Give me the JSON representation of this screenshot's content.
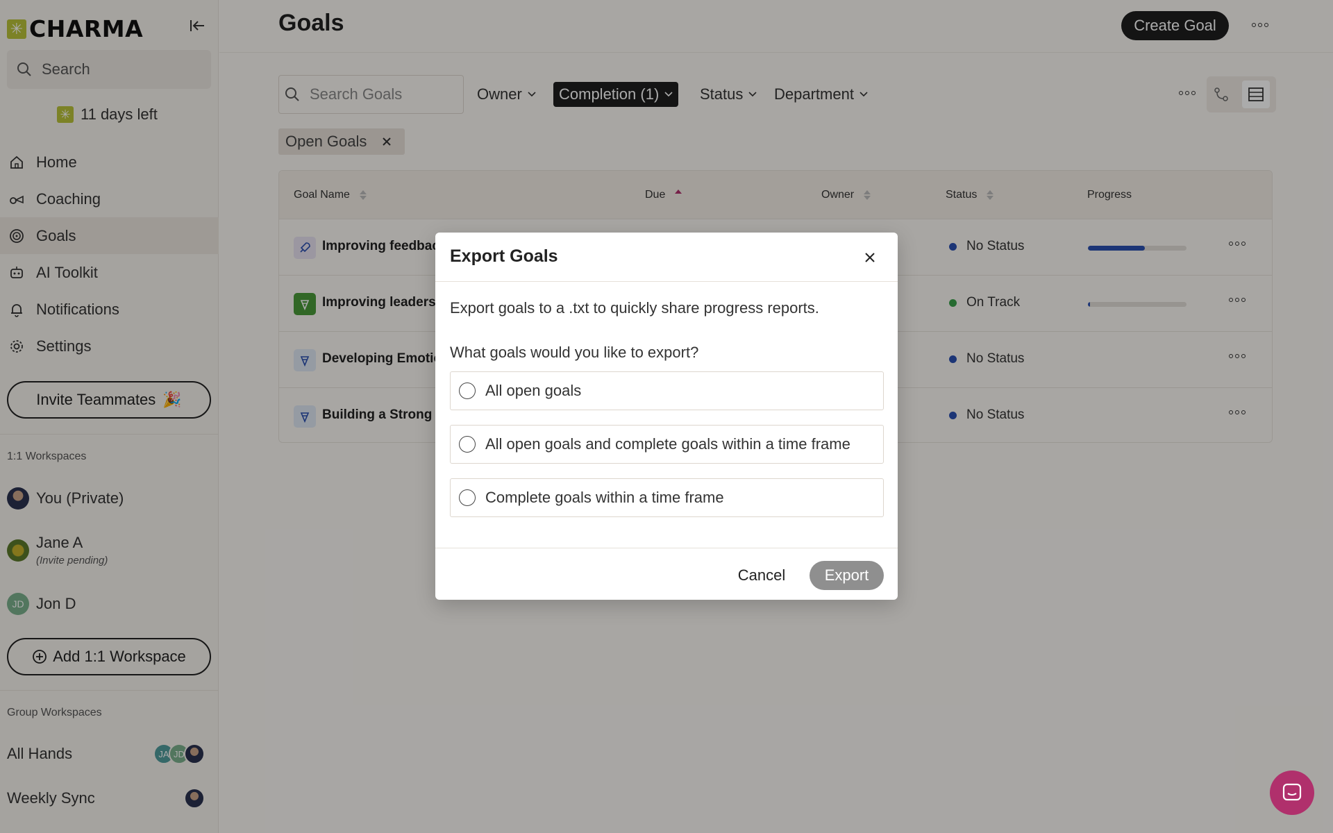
{
  "app": {
    "logo_text": "CHARMA",
    "accent_color": "#b9c23a",
    "chat_color": "#b0306c"
  },
  "sidebar": {
    "search_placeholder": "Search",
    "trial_text": "11 days left",
    "nav": [
      {
        "label": "Home",
        "icon": "home-icon"
      },
      {
        "label": "Coaching",
        "icon": "coaching-icon"
      },
      {
        "label": "Goals",
        "icon": "target-icon",
        "active": true
      },
      {
        "label": "AI Toolkit",
        "icon": "robot-icon"
      },
      {
        "label": "Notifications",
        "icon": "bell-icon"
      },
      {
        "label": "Settings",
        "icon": "gear-icon"
      }
    ],
    "invite_label": "Invite Teammates",
    "invite_emoji": "🎉",
    "one_on_one_label": "1:1 Workspaces",
    "workspaces": [
      {
        "name": "You (Private)",
        "sub": ""
      },
      {
        "name": "Jane A",
        "sub": "(Invite pending)"
      },
      {
        "name": "Jon D",
        "sub": "",
        "initials": "JD"
      }
    ],
    "add_workspace_label": "Add 1:1 Workspace",
    "group_label": "Group Workspaces",
    "groups": [
      {
        "name": "All Hands",
        "avatars": [
          "JA",
          "JD"
        ]
      },
      {
        "name": "Weekly Sync"
      }
    ]
  },
  "main": {
    "title": "Goals",
    "create_label": "Create Goal",
    "search_placeholder": "Search Goals",
    "filters": [
      {
        "label": "Owner"
      },
      {
        "label": "Completion (1)",
        "active": true
      },
      {
        "label": "Status"
      },
      {
        "label": "Department"
      }
    ],
    "chip_label": "Open Goals",
    "columns": {
      "goal_name": "Goal Name",
      "due": "Due",
      "owner": "Owner",
      "status": "Status",
      "progress": "Progress"
    },
    "rows": [
      {
        "name": "Improving feedback",
        "status": "No Status",
        "status_color": "#2b4fb0",
        "progress": 0.58,
        "icon_color": "#e8e2f1"
      },
      {
        "name": "Improving leadership",
        "status": "On Track",
        "status_color": "#3aa04a",
        "progress": 0.02,
        "icon_color": "#4a9a3a"
      },
      {
        "name": "Developing Emotional",
        "status": "No Status",
        "status_color": "#2b4fb0",
        "progress": null,
        "icon_color": "#dfe8f3"
      },
      {
        "name": "Building a Strong N",
        "status": "No Status",
        "status_color": "#2b4fb0",
        "progress": null,
        "icon_color": "#dfe8f3"
      }
    ]
  },
  "modal": {
    "title": "Export Goals",
    "description": "Export goals to a .txt to quickly share progress reports.",
    "question": "What goals would you like to export?",
    "options": [
      "All open goals",
      "All open goals and complete goals within a time frame",
      "Complete goals within a time frame"
    ],
    "cancel_label": "Cancel",
    "export_label": "Export"
  }
}
